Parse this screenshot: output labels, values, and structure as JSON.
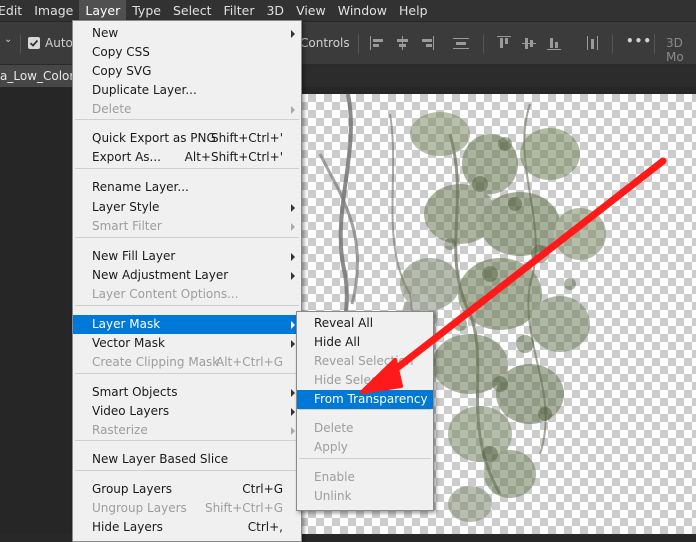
{
  "menubar": {
    "items": [
      "Edit",
      "Image",
      "Layer",
      "Type",
      "Select",
      "Filter",
      "3D",
      "View",
      "Window",
      "Help"
    ],
    "active_index": 2
  },
  "options": {
    "auto_select_label": "Auto-",
    "auto_select_checked": true,
    "show_transform_label": "Controls",
    "more_label": "•••",
    "three_d_label": "3D Mo"
  },
  "document": {
    "tab_title": "a_Low_Color."
  },
  "layer_menu": {
    "items": [
      {
        "label": "New",
        "shortcut": "",
        "submenu": true,
        "disabled": false
      },
      {
        "label": "Copy CSS",
        "shortcut": "",
        "submenu": false,
        "disabled": false
      },
      {
        "label": "Copy SVG",
        "shortcut": "",
        "submenu": false,
        "disabled": false
      },
      {
        "label": "Duplicate Layer...",
        "shortcut": "",
        "submenu": false,
        "disabled": false
      },
      {
        "label": "Delete",
        "shortcut": "",
        "submenu": true,
        "disabled": true
      },
      {
        "label": "Quick Export as PNG",
        "shortcut": "Shift+Ctrl+'",
        "submenu": false,
        "disabled": false
      },
      {
        "label": "Export As...",
        "shortcut": "Alt+Shift+Ctrl+'",
        "submenu": false,
        "disabled": false
      },
      {
        "label": "Rename Layer...",
        "shortcut": "",
        "submenu": false,
        "disabled": false
      },
      {
        "label": "Layer Style",
        "shortcut": "",
        "submenu": true,
        "disabled": false
      },
      {
        "label": "Smart Filter",
        "shortcut": "",
        "submenu": true,
        "disabled": true
      },
      {
        "label": "New Fill Layer",
        "shortcut": "",
        "submenu": true,
        "disabled": false
      },
      {
        "label": "New Adjustment Layer",
        "shortcut": "",
        "submenu": true,
        "disabled": false
      },
      {
        "label": "Layer Content Options...",
        "shortcut": "",
        "submenu": false,
        "disabled": true
      },
      {
        "label": "Layer Mask",
        "shortcut": "",
        "submenu": true,
        "disabled": false,
        "highlighted": true
      },
      {
        "label": "Vector Mask",
        "shortcut": "",
        "submenu": true,
        "disabled": false
      },
      {
        "label": "Create Clipping Mask",
        "shortcut": "Alt+Ctrl+G",
        "submenu": false,
        "disabled": true
      },
      {
        "label": "Smart Objects",
        "shortcut": "",
        "submenu": true,
        "disabled": false
      },
      {
        "label": "Video Layers",
        "shortcut": "",
        "submenu": true,
        "disabled": false
      },
      {
        "label": "Rasterize",
        "shortcut": "",
        "submenu": true,
        "disabled": true
      },
      {
        "label": "New Layer Based Slice",
        "shortcut": "",
        "submenu": false,
        "disabled": false
      },
      {
        "label": "Group Layers",
        "shortcut": "Ctrl+G",
        "submenu": false,
        "disabled": false
      },
      {
        "label": "Ungroup Layers",
        "shortcut": "Shift+Ctrl+G",
        "submenu": false,
        "disabled": true
      },
      {
        "label": "Hide Layers",
        "shortcut": "Ctrl+,",
        "submenu": false,
        "disabled": false
      }
    ]
  },
  "mask_menu": {
    "items": [
      {
        "label": "Reveal All",
        "disabled": false
      },
      {
        "label": "Hide All",
        "disabled": false
      },
      {
        "label": "Reveal Selection",
        "disabled": true
      },
      {
        "label": "Hide Selection",
        "disabled": true
      },
      {
        "label": "From Transparency",
        "disabled": false,
        "highlighted": true
      },
      {
        "label": "Delete",
        "disabled": true
      },
      {
        "label": "Apply",
        "disabled": true
      },
      {
        "label": "Enable",
        "disabled": true
      },
      {
        "label": "Unlink",
        "disabled": true
      }
    ]
  },
  "colors": {
    "highlight": "#0078d7",
    "annotation_arrow": "#ff1a1a",
    "menu_bg": "#f0f0f0",
    "app_bg": "#323232"
  }
}
